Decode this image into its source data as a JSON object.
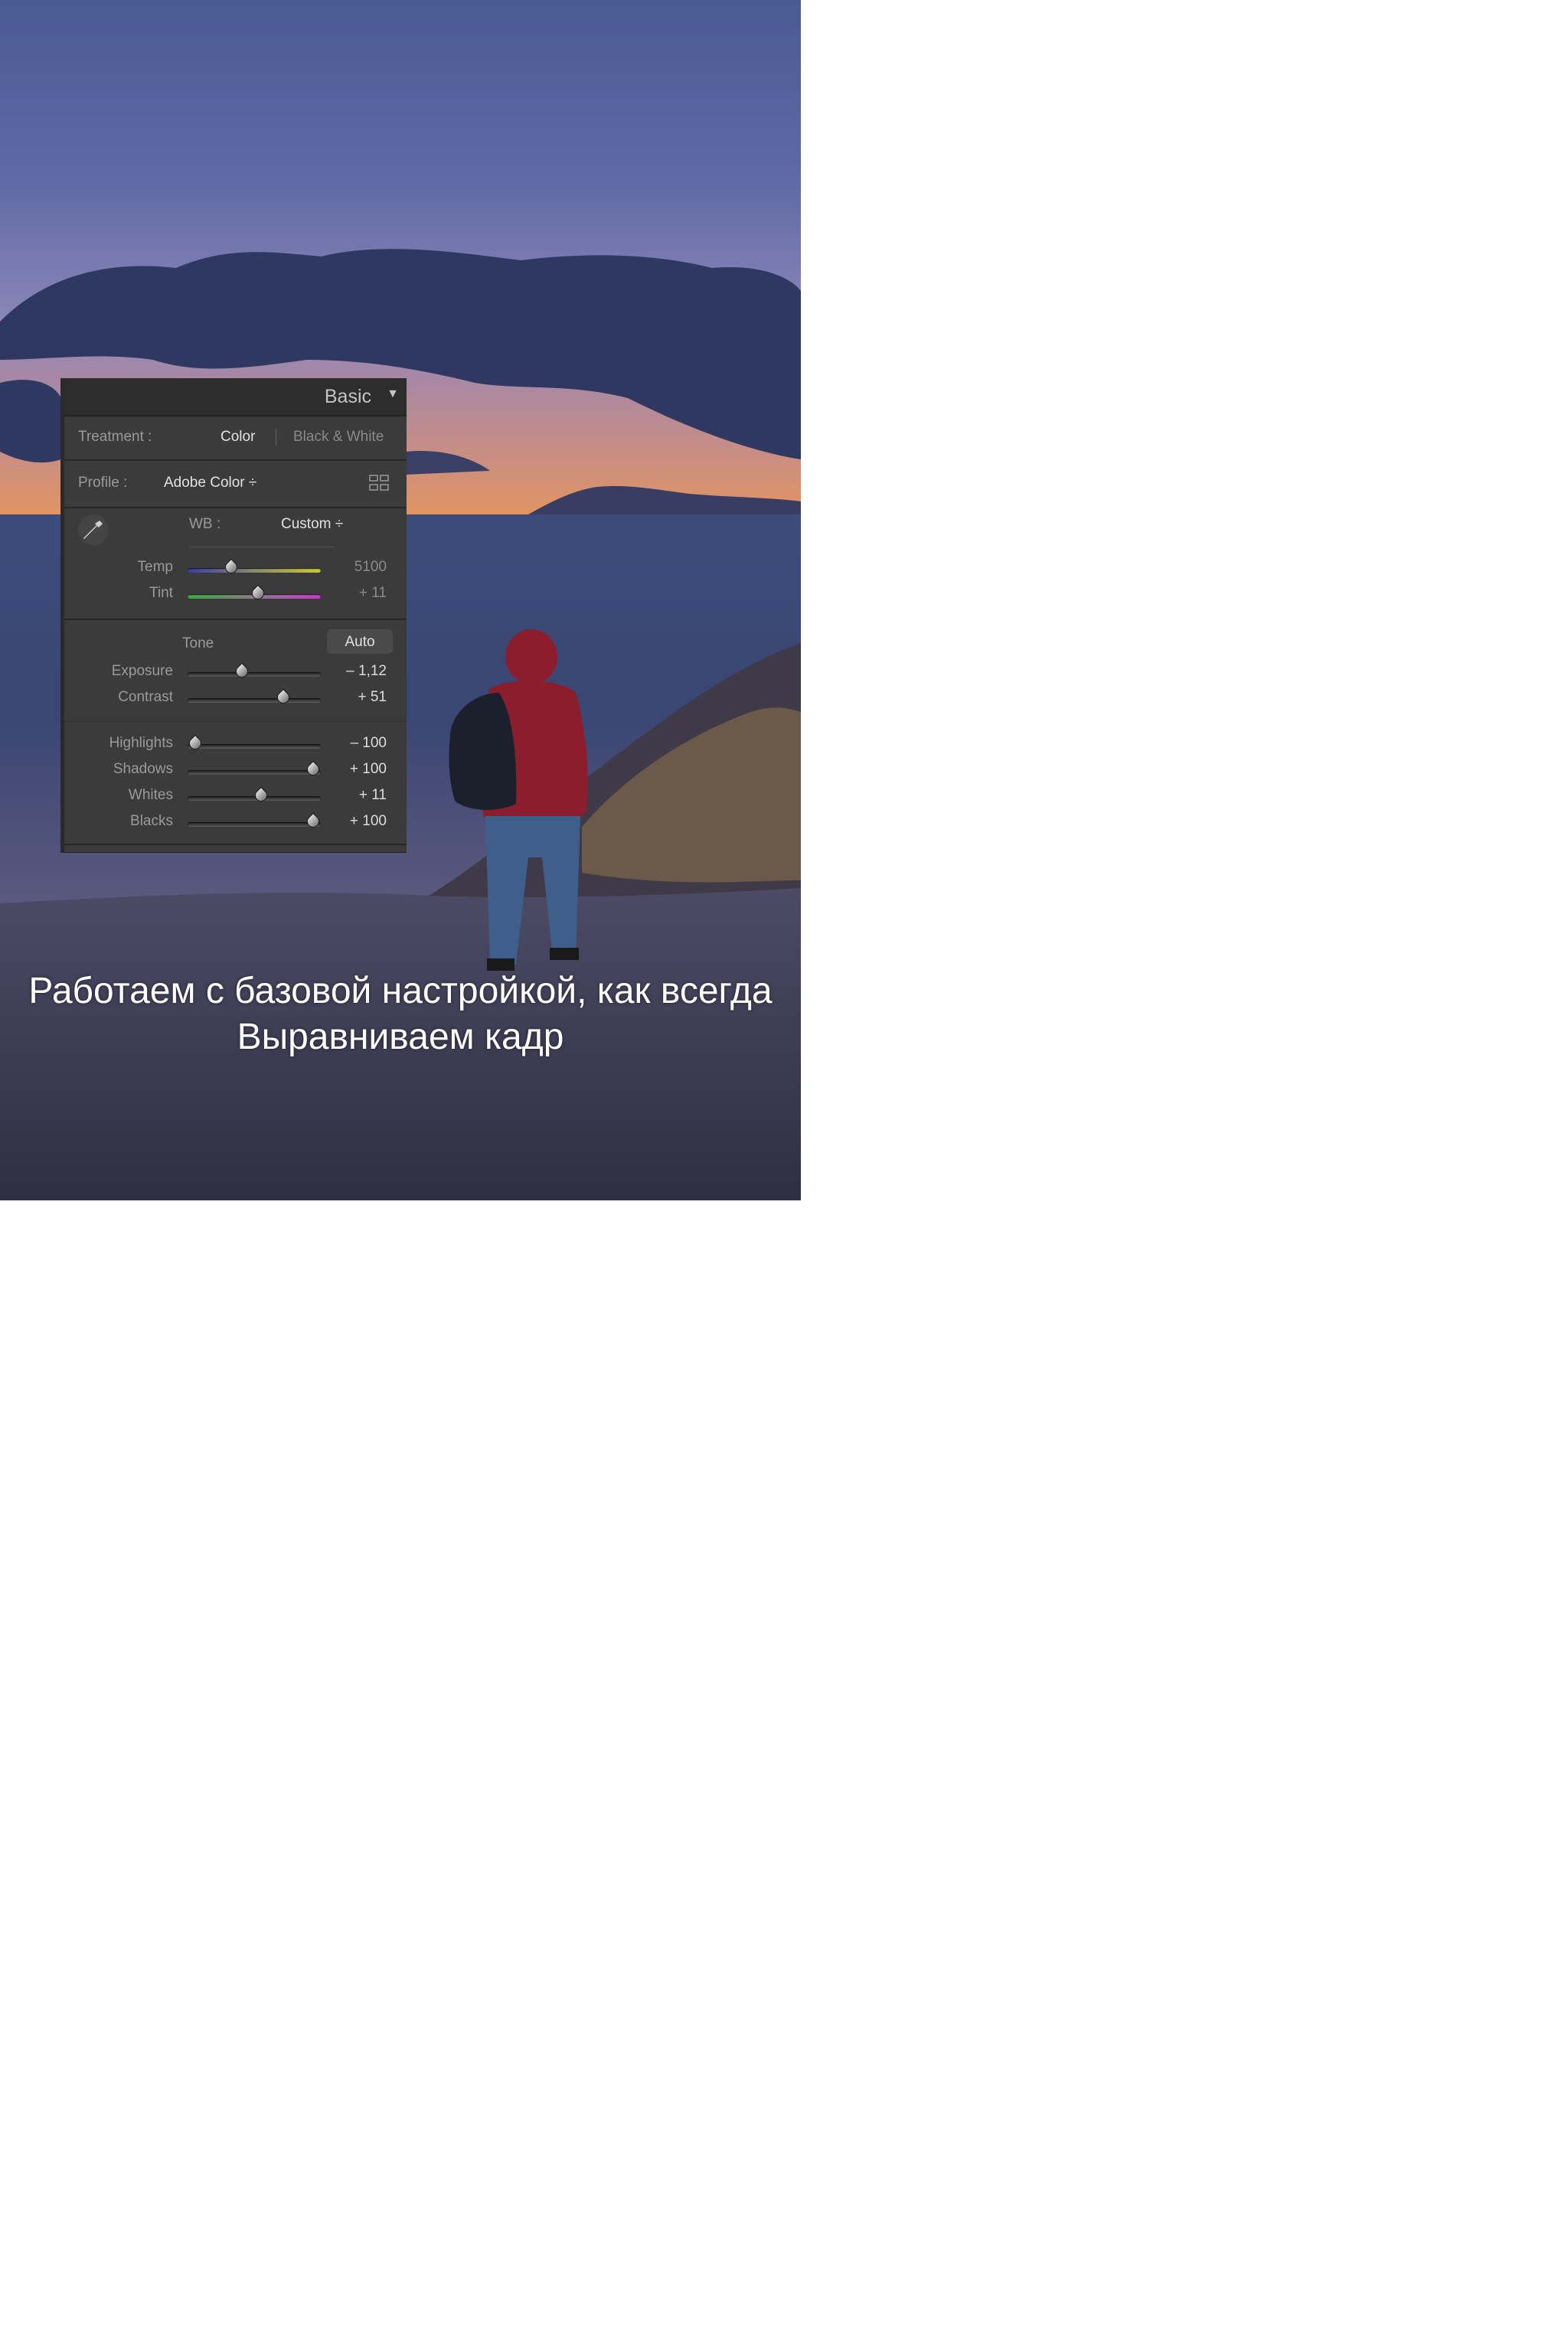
{
  "panel": {
    "title": "Basic",
    "treatment": {
      "label": "Treatment :",
      "color": "Color",
      "bw": "Black & White"
    },
    "profile": {
      "label": "Profile :",
      "value": "Adobe Color ÷"
    },
    "wb": {
      "label": "WB :",
      "value": "Custom ÷"
    },
    "sliders_wb": [
      {
        "label": "Temp",
        "value": "5100",
        "level": 0.33
      },
      {
        "label": "Tint",
        "value": "+ 11",
        "level": 0.53
      }
    ],
    "tone": {
      "label": "Tone",
      "auto": "Auto"
    },
    "sliders_tone": [
      {
        "label": "Exposure",
        "value": "– 1,12",
        "level": 0.41
      },
      {
        "label": "Contrast",
        "value": "+ 51",
        "level": 0.72
      }
    ],
    "sliders_presence": [
      {
        "label": "Highlights",
        "value": "– 100",
        "level": 0.06
      },
      {
        "label": "Shadows",
        "value": "+ 100",
        "level": 0.94
      },
      {
        "label": "Whites",
        "value": "+ 11",
        "level": 0.55
      },
      {
        "label": "Blacks",
        "value": "+ 100",
        "level": 0.94
      }
    ]
  },
  "caption": {
    "line1": "Работаем с базовой настройкой, как всегда",
    "line2": "Выравниваем кадр"
  }
}
